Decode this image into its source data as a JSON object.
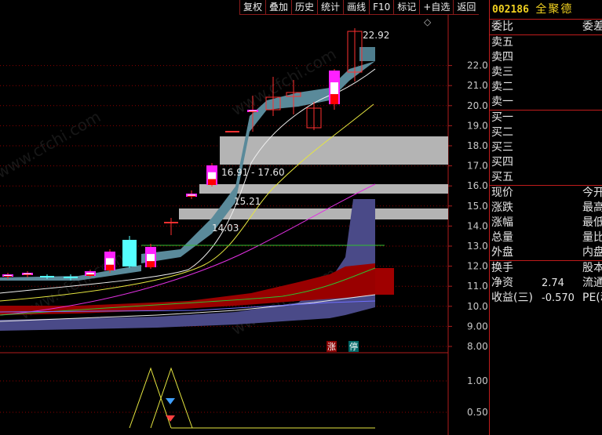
{
  "toolbar": {
    "items": [
      "复权",
      "叠加",
      "历史",
      "统计",
      "画线",
      "F10",
      "标记",
      "+自选",
      "返回"
    ]
  },
  "quote": {
    "code": "002186",
    "name": "全聚德",
    "weibi_label": "委比",
    "weicha_label": "委差",
    "sell_labels": [
      "卖五",
      "卖四",
      "卖三",
      "卖二",
      "卖一"
    ],
    "buy_labels": [
      "买一",
      "买二",
      "买三",
      "买四",
      "买五"
    ],
    "stats": [
      {
        "label": "现价",
        "value": "",
        "right": "今开"
      },
      {
        "label": "涨跌",
        "value": "",
        "right": "最高"
      },
      {
        "label": "涨幅",
        "value": "",
        "right": "最低"
      },
      {
        "label": "总量",
        "value": "",
        "right": "量比"
      },
      {
        "label": "外盘",
        "value": "",
        "right": "内盘"
      }
    ],
    "stats2": [
      {
        "label": "换手",
        "value": "",
        "right": "股本"
      },
      {
        "label": "净资",
        "value": "2.74",
        "right": "流通"
      },
      {
        "label": "收益(三)",
        "value": "-0.570",
        "right": "PE(动)"
      }
    ]
  },
  "chart": {
    "price_axis": [
      "22.00",
      "21.00",
      "20.00",
      "19.00",
      "18.00",
      "17.00",
      "16.00",
      "15.00",
      "14.00",
      "13.00",
      "12.00",
      "11.00",
      "10.00",
      "9.00",
      "8.00"
    ],
    "annotations": {
      "high": "22.92",
      "zone1": "16.91 - 17.60",
      "zone2": "15.21",
      "zone3": "14.03"
    },
    "markers": {
      "zhang": "涨",
      "ting": "停"
    },
    "indicator_axis": [
      "1.00",
      "0.50"
    ],
    "watermark": "www.cfchi.com",
    "colors": {
      "up": "#ff3030",
      "down": "#54ffff",
      "grid": "#8a0000",
      "cloud": "#5a8a9a",
      "purple": "#4a4a88",
      "red_band": "#990000"
    }
  }
}
